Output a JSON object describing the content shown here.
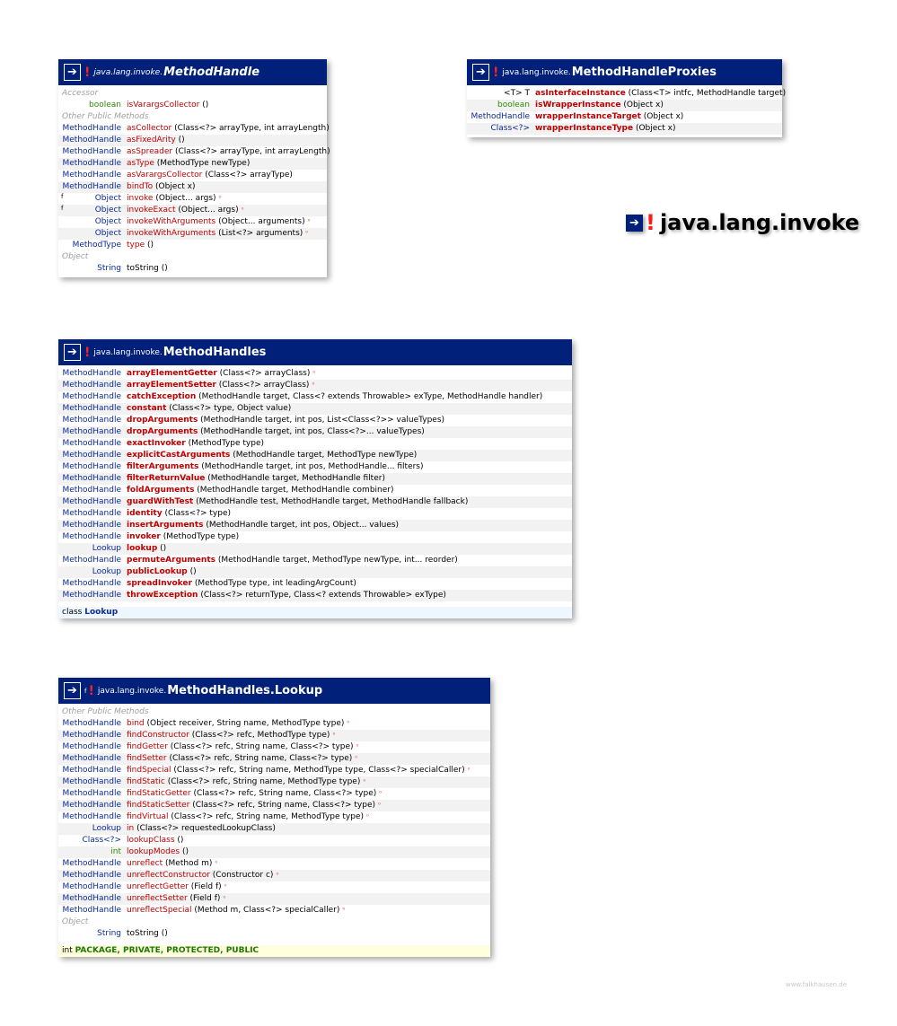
{
  "page_title": "java.lang.invoke",
  "watermark": "www.falkhausen.de",
  "boxes": [
    {
      "pkg": "java.lang.invoke.",
      "name": "MethodHandle",
      "italic": true,
      "sup": "",
      "sections": [
        {
          "label": "Accessor",
          "rows": [
            {
              "type": "boolean",
              "type_green": true,
              "method": "isVarargsCollector",
              "params": " ()"
            }
          ]
        },
        {
          "label": "Other Public Methods",
          "rows": [
            {
              "type": "MethodHandle",
              "method": "asCollector",
              "params": " (Class<?> arrayType, int arrayLength)"
            },
            {
              "type": "MethodHandle",
              "method": "asFixedArity",
              "params": " ()"
            },
            {
              "type": "MethodHandle",
              "method": "asSpreader",
              "params": " (Class<?> arrayType, int arrayLength)"
            },
            {
              "type": "MethodHandle",
              "method": "asType",
              "params": " (MethodType newType)"
            },
            {
              "type": "MethodHandle",
              "method": "asVarargsCollector",
              "params": " (Class<?> arrayType)"
            },
            {
              "type": "MethodHandle",
              "method": "bindTo",
              "params": " (Object x)"
            },
            {
              "mark": "f",
              "type": "Object",
              "method": "invoke",
              "params": " (Object... args)",
              "flag": "⁰"
            },
            {
              "mark": "f",
              "type": "Object",
              "method": "invokeExact",
              "params": " (Object... args)",
              "flag": "⁰"
            },
            {
              "type": "Object",
              "method": "invokeWithArguments",
              "params": " (Object... arguments)",
              "flag": "⁰"
            },
            {
              "type": "Object",
              "method": "invokeWithArguments",
              "params": " (List<?> arguments)",
              "flag": "⁰"
            },
            {
              "type": "MethodType",
              "method": "type",
              "params": " ()"
            }
          ]
        },
        {
          "label": "Object",
          "rows": [
            {
              "type": "String",
              "method": "toString",
              "method_plain": true,
              "params": " ()"
            }
          ]
        }
      ]
    },
    {
      "pkg": "java.lang.invoke.",
      "name": "MethodHandleProxies",
      "italic": false,
      "sup": "",
      "sections": [
        {
          "label": "",
          "rows": [
            {
              "type": "<T> T",
              "type_black": true,
              "method": "asInterfaceInstance",
              "bold": true,
              "params": " (Class<T> intfc, MethodHandle target)"
            },
            {
              "type": "boolean",
              "type_green": true,
              "method": "isWrapperInstance",
              "bold": true,
              "params": " (Object x)"
            },
            {
              "type": "MethodHandle",
              "method": "wrapperInstanceTarget",
              "bold": true,
              "params": " (Object x)"
            },
            {
              "type": "Class<?>",
              "method": "wrapperInstanceType",
              "bold": true,
              "params": " (Object x)"
            }
          ]
        }
      ]
    },
    {
      "pkg": "java.lang.invoke.",
      "name": "MethodHandles",
      "italic": false,
      "sup": "",
      "sections": [
        {
          "label": "",
          "rows": [
            {
              "type": "MethodHandle",
              "method": "arrayElementGetter",
              "bold": true,
              "params": " (Class<?> arrayClass)",
              "flag": "⁰"
            },
            {
              "type": "MethodHandle",
              "method": "arrayElementSetter",
              "bold": true,
              "params": " (Class<?> arrayClass)",
              "flag": "⁰"
            },
            {
              "type": "MethodHandle",
              "method": "catchException",
              "bold": true,
              "params": " (MethodHandle target, Class<? extends Throwable> exType, MethodHandle handler)"
            },
            {
              "type": "MethodHandle",
              "method": "constant",
              "bold": true,
              "params": " (Class<?> type, Object value)"
            },
            {
              "type": "MethodHandle",
              "method": "dropArguments",
              "bold": true,
              "params": " (MethodHandle target, int pos, List<Class<?>> valueTypes)"
            },
            {
              "type": "MethodHandle",
              "method": "dropArguments",
              "bold": true,
              "params": " (MethodHandle target, int pos, Class<?>... valueTypes)"
            },
            {
              "type": "MethodHandle",
              "method": "exactInvoker",
              "bold": true,
              "params": " (MethodType type)"
            },
            {
              "type": "MethodHandle",
              "method": "explicitCastArguments",
              "bold": true,
              "params": " (MethodHandle target, MethodType newType)"
            },
            {
              "type": "MethodHandle",
              "method": "filterArguments",
              "bold": true,
              "params": " (MethodHandle target, int pos, MethodHandle... filters)"
            },
            {
              "type": "MethodHandle",
              "method": "filterReturnValue",
              "bold": true,
              "params": " (MethodHandle target, MethodHandle filter)"
            },
            {
              "type": "MethodHandle",
              "method": "foldArguments",
              "bold": true,
              "params": " (MethodHandle target, MethodHandle combiner)"
            },
            {
              "type": "MethodHandle",
              "method": "guardWithTest",
              "bold": true,
              "params": " (MethodHandle test, MethodHandle target, MethodHandle fallback)"
            },
            {
              "type": "MethodHandle",
              "method": "identity",
              "bold": true,
              "params": " (Class<?> type)"
            },
            {
              "type": "MethodHandle",
              "method": "insertArguments",
              "bold": true,
              "params": " (MethodHandle target, int pos, Object... values)"
            },
            {
              "type": "MethodHandle",
              "method": "invoker",
              "bold": true,
              "params": " (MethodType type)"
            },
            {
              "type": "Lookup",
              "method": "lookup",
              "bold": true,
              "params": " ()"
            },
            {
              "type": "MethodHandle",
              "method": "permuteArguments",
              "bold": true,
              "params": " (MethodHandle target, MethodType newType, int... reorder)"
            },
            {
              "type": "Lookup",
              "method": "publicLookup",
              "bold": true,
              "params": " ()"
            },
            {
              "type": "MethodHandle",
              "method": "spreadInvoker",
              "bold": true,
              "params": " (MethodType type, int leadingArgCount)"
            },
            {
              "type": "MethodHandle",
              "method": "throwException",
              "bold": true,
              "params": " (Class<?> returnType, Class<? extends Throwable> exType)"
            }
          ]
        }
      ],
      "footer": {
        "key": "class",
        "value": "Lookup",
        "style": "blue"
      }
    },
    {
      "pkg": "java.lang.invoke.",
      "name": "MethodHandles.Lookup",
      "italic": false,
      "sup": "f",
      "sections": [
        {
          "label": "Other Public Methods",
          "rows": [
            {
              "type": "MethodHandle",
              "method": "bind",
              "params": " (Object receiver, String name, MethodType type)",
              "flag": "⁰"
            },
            {
              "type": "MethodHandle",
              "method": "findConstructor",
              "params": " (Class<?> refc, MethodType type)",
              "flag": "⁰"
            },
            {
              "type": "MethodHandle",
              "method": "findGetter",
              "params": " (Class<?> refc, String name, Class<?> type)",
              "flag": "⁰"
            },
            {
              "type": "MethodHandle",
              "method": "findSetter",
              "params": " (Class<?> refc, String name, Class<?> type)",
              "flag": "⁰"
            },
            {
              "type": "MethodHandle",
              "method": "findSpecial",
              "params": " (Class<?> refc, String name, MethodType type, Class<?> specialCaller)",
              "flag": "⁰"
            },
            {
              "type": "MethodHandle",
              "method": "findStatic",
              "params": " (Class<?> refc, String name, MethodType type)",
              "flag": "⁰"
            },
            {
              "type": "MethodHandle",
              "method": "findStaticGetter",
              "params": " (Class<?> refc, String name, Class<?> type)",
              "flag": "⁰"
            },
            {
              "type": "MethodHandle",
              "method": "findStaticSetter",
              "params": " (Class<?> refc, String name, Class<?> type)",
              "flag": "⁰"
            },
            {
              "type": "MethodHandle",
              "method": "findVirtual",
              "params": " (Class<?> refc, String name, MethodType type)",
              "flag": "⁰"
            },
            {
              "type": "Lookup",
              "method": "in",
              "params": " (Class<?> requestedLookupClass)"
            },
            {
              "type": "Class<?>",
              "method": "lookupClass",
              "params": " ()"
            },
            {
              "type": "int",
              "type_green": true,
              "method": "lookupModes",
              "params": " ()"
            },
            {
              "type": "MethodHandle",
              "method": "unreflect",
              "params": " (Method m)",
              "flag": "⁰"
            },
            {
              "type": "MethodHandle",
              "method": "unreflectConstructor",
              "params": " (Constructor c)",
              "flag": "⁰"
            },
            {
              "type": "MethodHandle",
              "method": "unreflectGetter",
              "params": " (Field f)",
              "flag": "⁰"
            },
            {
              "type": "MethodHandle",
              "method": "unreflectSetter",
              "params": " (Field f)",
              "flag": "⁰"
            },
            {
              "type": "MethodHandle",
              "method": "unreflectSpecial",
              "params": " (Method m, Class<?> specialCaller)",
              "flag": "⁰"
            }
          ]
        },
        {
          "label": "Object",
          "rows": [
            {
              "type": "String",
              "method": "toString",
              "method_plain": true,
              "params": " ()"
            }
          ]
        }
      ],
      "footer": {
        "key": "int",
        "value": "PACKAGE, PRIVATE, PROTECTED, PUBLIC",
        "style": "yellow"
      }
    }
  ]
}
